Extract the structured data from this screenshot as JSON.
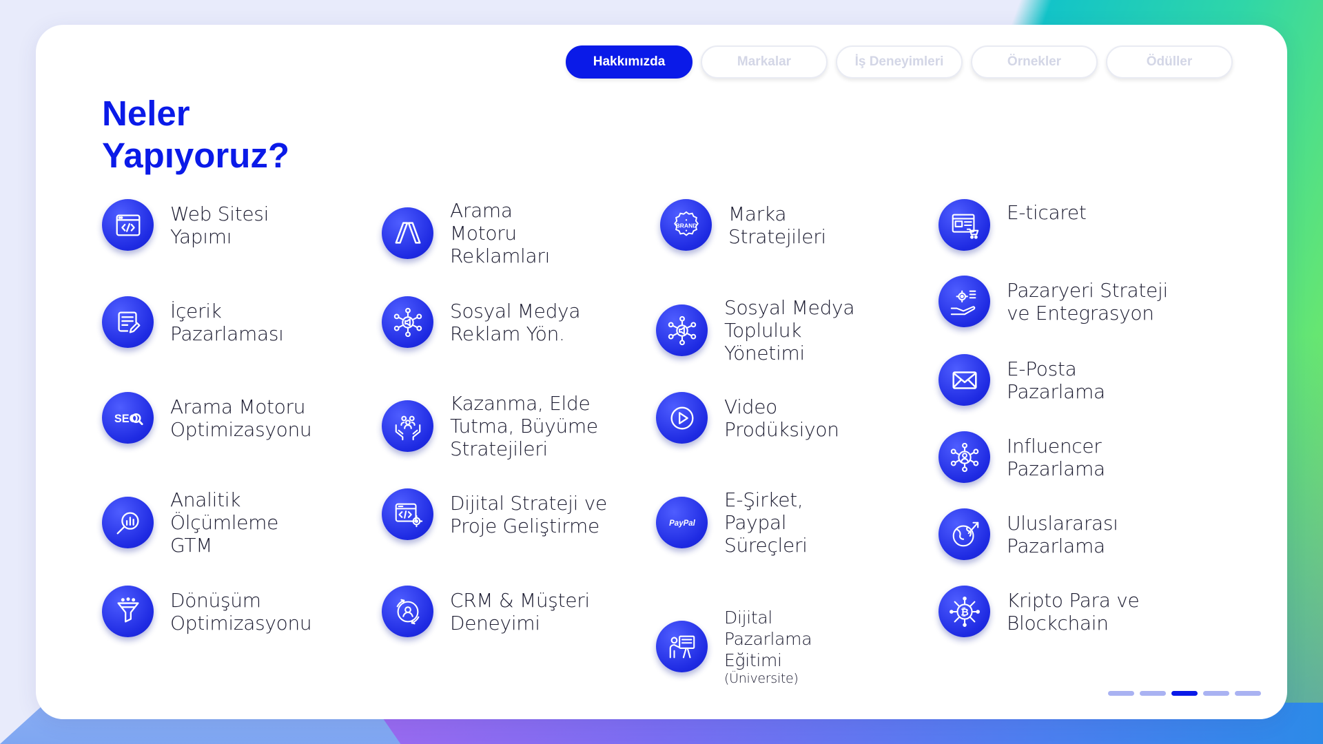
{
  "tabs": [
    {
      "label": "Hakkımızda",
      "active": true
    },
    {
      "label": "Markalar",
      "active": false
    },
    {
      "label": "İş Deneyimleri",
      "active": false
    },
    {
      "label": "Örnekler",
      "active": false
    },
    {
      "label": "Ödüller",
      "active": false
    }
  ],
  "title": {
    "line1": "Neler",
    "line2": "Yapıyoruz?"
  },
  "services": [
    {
      "label": "Web Sitesi\nYapımı",
      "icon": "code-window-icon"
    },
    {
      "label": "İçerik\nPazarlaması",
      "icon": "content-edit-icon"
    },
    {
      "label": "Arama Motoru\nOptimizasyonu",
      "icon": "seo-icon"
    },
    {
      "label": "Analitik\nÖlçümleme\nGTM",
      "icon": "analytics-icon"
    },
    {
      "label": "Dönüşüm\nOptimizasyonu",
      "icon": "funnel-icon"
    },
    {
      "label": "Arama\nMotoru\nReklamları",
      "icon": "google-ads-icon"
    },
    {
      "label": "Sosyal Medya\nReklam Yön.",
      "icon": "social-ads-icon"
    },
    {
      "label": "Kazanma, Elde\nTutma, Büyüme\nStratejileri",
      "icon": "people-hands-icon"
    },
    {
      "label": "Dijital Strateji ve\nProje Geliştirme",
      "icon": "project-code-icon"
    },
    {
      "label": "CRM & Müşteri\nDeneyimi",
      "icon": "crm-icon"
    },
    {
      "label": "Marka\nStratejileri",
      "icon": "brand-badge-icon"
    },
    {
      "label": "Sosyal Medya\nTopluluk\nYönetimi",
      "icon": "community-icon"
    },
    {
      "label": "Video\nProdüksiyon",
      "icon": "play-icon"
    },
    {
      "label": "E-Şirket,\nPaypal\nSüreçleri",
      "icon": "paypal-icon"
    },
    {
      "label": "Dijital\nPazarlama\nEğitimi",
      "sub": "(Üniversite)",
      "icon": "training-icon"
    },
    {
      "label": "E-ticaret",
      "icon": "ecommerce-icon"
    },
    {
      "label": "Pazaryeri Strateji\nve Entegrasyon",
      "icon": "hand-gear-icon"
    },
    {
      "label": "E-Posta\nPazarlama",
      "icon": "envelope-icon"
    },
    {
      "label": "Influencer\nPazarlama",
      "icon": "influencer-icon"
    },
    {
      "label": "Uluslararası\nPazarlama",
      "icon": "globe-icon"
    },
    {
      "label": "Kripto Para ve\nBlockchain",
      "icon": "bitcoin-icon"
    }
  ],
  "pagination": {
    "count": 5,
    "active_index": 2
  },
  "colors": {
    "brand": "#0a1ae8",
    "icon_bg": "#1e2ae2",
    "text": "#1b1b30"
  }
}
